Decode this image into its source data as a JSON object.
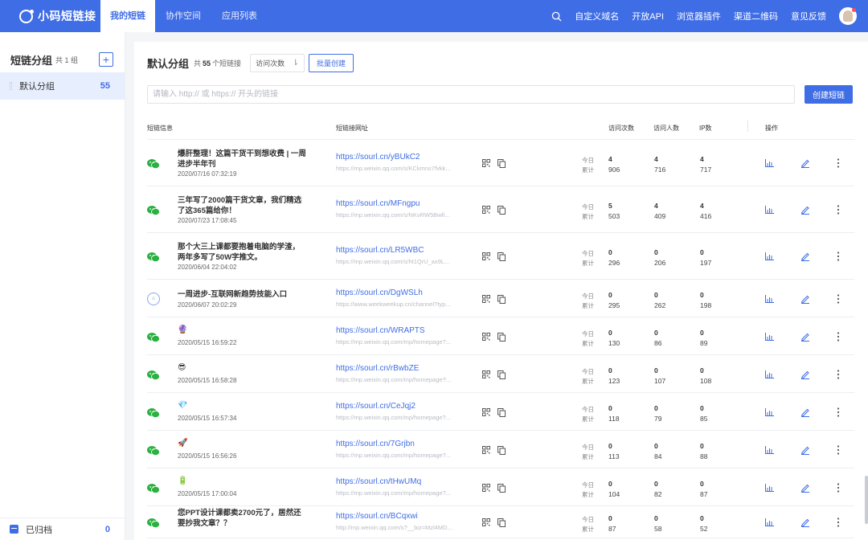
{
  "colors": {
    "accent": "#3f6de6",
    "wechat": "#2ab140"
  },
  "topbar": {
    "logo": "小码短链接",
    "nav": [
      {
        "label": "我的短链",
        "active": true
      },
      {
        "label": "协作空间",
        "active": false
      },
      {
        "label": "应用列表",
        "active": false
      }
    ],
    "links": [
      "自定义域名",
      "开放API",
      "浏览器插件",
      "渠道二维码",
      "意见反馈"
    ]
  },
  "sidebar": {
    "title": "短链分组",
    "count": "共 1 组",
    "group": {
      "name": "默认分组",
      "num": "55"
    },
    "archive": {
      "name": "已归档",
      "num": "0"
    }
  },
  "main": {
    "title": "默认分组",
    "sub_prefix": "共",
    "sub_num": "55",
    "sub_suffix": "个短链接",
    "sort_label": "访问次数",
    "batch_label": "批量创建",
    "input_placeholder": "请输入 http:// 或 https:// 开头的链接",
    "create_label": "创建短链"
  },
  "table": {
    "headers": [
      "短链信息",
      "短链接网址",
      "访问次数",
      "访问人数",
      "IP数",
      "操作"
    ],
    "today_label": "今日",
    "total_label": "累计",
    "rows": [
      {
        "icon": "wechat",
        "title": "爆肝整理！这篇干货干到想收费 | 一周进步半年刊",
        "emoji": "",
        "time": "2020/07/16 07:32:19",
        "short": "https://sourl.cn/yBUkC2",
        "long": "https://mp.weixin.qq.com/s/KCkmns7fvkk...",
        "visits_today": "4",
        "visits_total": "906",
        "users_today": "4",
        "users_total": "716",
        "ip_today": "4",
        "ip_total": "717"
      },
      {
        "icon": "wechat",
        "title": "三年写了2000篇干货文章，我们精选了这365篇给你！",
        "emoji": "",
        "time": "2020/07/23 17:08:45",
        "short": "https://sourl.cn/MFngpu",
        "long": "https://mp.weixin.qq.com/s/NKvRW5Bwfi...",
        "visits_today": "5",
        "visits_total": "503",
        "users_today": "4",
        "users_total": "409",
        "ip_today": "4",
        "ip_total": "416"
      },
      {
        "icon": "wechat",
        "title": "那个大三上课都要抱着电脑的学渣，两年多写了50W字推文。",
        "emoji": "",
        "time": "2020/06/04 22:04:02",
        "short": "https://sourl.cn/LR5WBC",
        "long": "https://mp.weixin.qq.com/s/ht1QrU_ax9L...",
        "visits_today": "0",
        "visits_total": "296",
        "users_today": "0",
        "users_total": "206",
        "ip_today": "0",
        "ip_total": "197"
      },
      {
        "icon": "web",
        "title": "一周进步-互联网新趋势技能入口",
        "emoji": "",
        "time": "2020/06/07 20:02:29",
        "short": "https://sourl.cn/DgWSLh",
        "long": "https://www.weekweekup.cn/channel?typ...",
        "visits_today": "0",
        "visits_total": "295",
        "users_today": "0",
        "users_total": "262",
        "ip_today": "0",
        "ip_total": "198"
      },
      {
        "icon": "wechat",
        "title": "",
        "emoji": "🔮",
        "time": "2020/05/15 16:59:22",
        "short": "https://sourl.cn/WRAPTS",
        "long": "https://mp.weixin.qq.com/mp/homepage?...",
        "visits_today": "0",
        "visits_total": "130",
        "users_today": "0",
        "users_total": "86",
        "ip_today": "0",
        "ip_total": "89"
      },
      {
        "icon": "wechat",
        "title": "",
        "emoji": "😎",
        "time": "2020/05/15 16:58:28",
        "short": "https://sourl.cn/rBwbZE",
        "long": "https://mp.weixin.qq.com/mp/homepage?...",
        "visits_today": "0",
        "visits_total": "123",
        "users_today": "0",
        "users_total": "107",
        "ip_today": "0",
        "ip_total": "108"
      },
      {
        "icon": "wechat",
        "title": "",
        "emoji": "💎",
        "time": "2020/05/15 16:57:34",
        "short": "https://sourl.cn/CeJqj2",
        "long": "https://mp.weixin.qq.com/mp/homepage?...",
        "visits_today": "0",
        "visits_total": "118",
        "users_today": "0",
        "users_total": "79",
        "ip_today": "0",
        "ip_total": "85"
      },
      {
        "icon": "wechat",
        "title": "",
        "emoji": "🚀",
        "time": "2020/05/15 16:56:26",
        "short": "https://sourl.cn/7Grjbn",
        "long": "https://mp.weixin.qq.com/mp/homepage?...",
        "visits_today": "0",
        "visits_total": "113",
        "users_today": "0",
        "users_total": "84",
        "ip_today": "0",
        "ip_total": "88"
      },
      {
        "icon": "wechat",
        "title": "",
        "emoji": "🔋",
        "time": "2020/05/15 17:00:04",
        "short": "https://sourl.cn/tHwUMq",
        "long": "https://mp.weixin.qq.com/mp/homepage?...",
        "visits_today": "0",
        "visits_total": "104",
        "users_today": "0",
        "users_total": "82",
        "ip_today": "0",
        "ip_total": "87"
      },
      {
        "icon": "wechat",
        "title": "您PPT设计课都卖2700元了，居然还要抄我文章？？",
        "emoji": "",
        "time": "",
        "short": "https://sourl.cn/BCqxwi",
        "long": "http://mp.weixin.qq.com/s?__biz=Mzl4MD...",
        "visits_today": "0",
        "visits_total": "87",
        "users_today": "0",
        "users_total": "58",
        "ip_today": "0",
        "ip_total": "52"
      }
    ]
  }
}
